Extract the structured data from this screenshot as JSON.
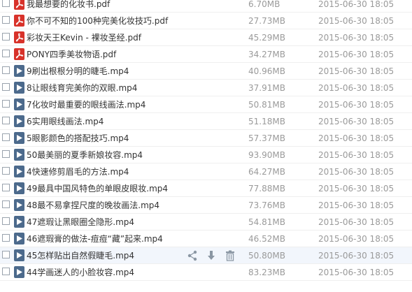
{
  "files": [
    {
      "name": "我最想要的化妆书.pdf",
      "type": "pdf",
      "size": "6.70MB",
      "date": "2015-06-30 18:05"
    },
    {
      "name": "你不可不知的100种完美化妆技巧.pdf",
      "type": "pdf",
      "size": "27.73MB",
      "date": "2015-06-30 18:05"
    },
    {
      "name": "彩妆天王Kevin - 裸妆圣经.pdf",
      "type": "pdf",
      "size": "45.29MB",
      "date": "2015-06-30 18:05"
    },
    {
      "name": "PONY四季美妆物语.pdf",
      "type": "pdf",
      "size": "34.27MB",
      "date": "2015-06-30 18:05"
    },
    {
      "name": "9刷出根根分明的睫毛.mp4",
      "type": "mp4",
      "size": "40.96MB",
      "date": "2015-06-30 18:05"
    },
    {
      "name": "8让眼线育完美你的双眼.mp4",
      "type": "mp4",
      "size": "37.91MB",
      "date": "2015-06-30 18:05"
    },
    {
      "name": "7化妆时最重要的眼线画法.mp4",
      "type": "mp4",
      "size": "50.81MB",
      "date": "2015-06-30 18:05"
    },
    {
      "name": "6实用眼线画法.mp4",
      "type": "mp4",
      "size": "51.18MB",
      "date": "2015-06-30 18:05"
    },
    {
      "name": "5眼影颜色的搭配技巧.mp4",
      "type": "mp4",
      "size": "57.37MB",
      "date": "2015-06-30 18:05"
    },
    {
      "name": "50最美丽的夏季新娘妆容.mp4",
      "type": "mp4",
      "size": "93.90MB",
      "date": "2015-06-30 18:05"
    },
    {
      "name": "4快速修剪眉毛的方法.mp4",
      "type": "mp4",
      "size": "64.27MB",
      "date": "2015-06-30 18:05"
    },
    {
      "name": "49最具中国风特色的单眼皮眼妆.mp4",
      "type": "mp4",
      "size": "77.88MB",
      "date": "2015-06-30 18:05"
    },
    {
      "name": "48最不易拿捏尺度的晚妆画法.mp4",
      "type": "mp4",
      "size": "73.76MB",
      "date": "2015-06-30 18:05"
    },
    {
      "name": "47遮瑕让黑眼圈全隐形.mp4",
      "type": "mp4",
      "size": "54.81MB",
      "date": "2015-06-30 18:05"
    },
    {
      "name": "46遮瑕膏的做法-痘痘“藏”起来.mp4",
      "type": "mp4",
      "size": "46.52MB",
      "date": "2015-06-30 18:05"
    },
    {
      "name": "45怎样贴出自然假睫毛.mp4",
      "type": "mp4",
      "size": "50.80MB",
      "date": "2015-06-30 18:05",
      "hover": true
    },
    {
      "name": "44学画迷人的小脸妆容.mp4",
      "type": "mp4",
      "size": "83.23MB",
      "date": "2015-06-30 18:05"
    }
  ],
  "row_actions": [
    "share-icon",
    "download-icon",
    "delete-icon"
  ],
  "colors": {
    "pdf": "#d8322a",
    "mp4": "#4c6a8c",
    "hover_bg": "#f2f6fc",
    "meta_text": "#9a9a9a"
  }
}
